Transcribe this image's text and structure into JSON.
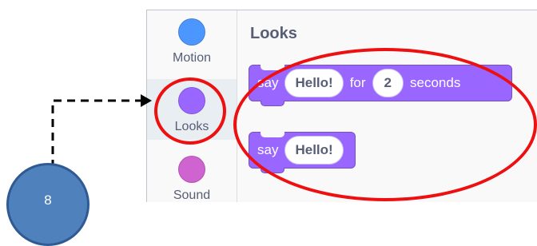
{
  "categories": [
    {
      "id": "motion",
      "label": "Motion",
      "color": "#4c97ff"
    },
    {
      "id": "looks",
      "label": "Looks",
      "color": "#9966ff"
    },
    {
      "id": "sound",
      "label": "Sound",
      "color": "#cf63cf"
    }
  ],
  "palette": {
    "section_title": "Looks",
    "blocks": [
      {
        "word1": "say",
        "value1": "Hello!",
        "word2": "for",
        "value2": "2",
        "word3": "seconds"
      },
      {
        "word1": "say",
        "value1": "Hello!"
      }
    ]
  },
  "marker": {
    "number": "8"
  },
  "colors": {
    "annotation_red": "#ee1010",
    "marker_blue": "#4f81bd",
    "looks_purple": "#9966ff"
  }
}
